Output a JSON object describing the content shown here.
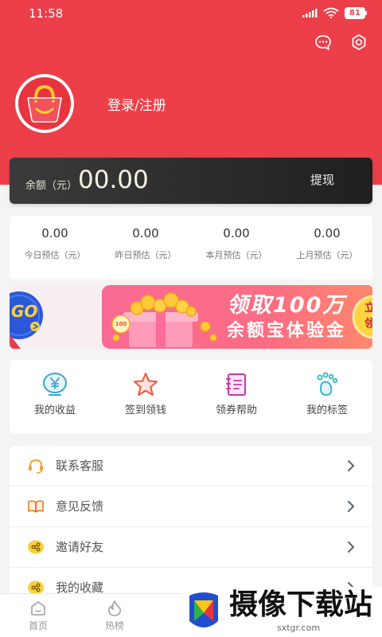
{
  "colors": {
    "brand_red": "#ec3f49",
    "page_bg": "#f4f4f4",
    "balance_card": "#2b2b2b",
    "chevron": "#5b6478"
  },
  "status_bar": {
    "time": "11:58",
    "battery_level": "81",
    "icons": [
      "signal-icon",
      "wifi-icon",
      "battery-icon"
    ]
  },
  "header": {
    "action_icons": [
      "message-icon",
      "settings-icon"
    ],
    "avatar_icon": "shopping-bag-avatar",
    "login_label": "登录/注册"
  },
  "balance": {
    "label": "余额（元）",
    "amount": "00.00",
    "withdraw_label": "提现"
  },
  "estimates": [
    {
      "value": "0.00",
      "label": "今日预估（元）"
    },
    {
      "value": "0.00",
      "label": "昨日预估（元）"
    },
    {
      "value": "0.00",
      "label": "本月预估（元）"
    },
    {
      "value": "0.00",
      "label": "上月预估（元）"
    }
  ],
  "banner": {
    "prev_slide_text": "GO",
    "headline": "领取100万",
    "subline": "余额宝体验金",
    "box_badge": "100",
    "badge_top": "立",
    "badge_bottom": "领"
  },
  "shortcuts": [
    {
      "label": "我的收益",
      "icon": "yuan-earnings-icon"
    },
    {
      "label": "签到领钱",
      "icon": "star-icon"
    },
    {
      "label": "领券帮助",
      "icon": "notebook-icon"
    },
    {
      "label": "我的标签",
      "icon": "footprint-icon"
    }
  ],
  "menu": [
    {
      "label": "联系客服",
      "icon": "headset-icon"
    },
    {
      "label": "意见反馈",
      "icon": "open-book-icon"
    },
    {
      "label": "邀请好友",
      "icon": "share-icon"
    },
    {
      "label": "我的收藏",
      "icon": "favorites-icon"
    }
  ],
  "tabbar": [
    {
      "label": "首页",
      "icon": "home-icon"
    },
    {
      "label": "热榜",
      "icon": "fire-icon"
    }
  ],
  "watermark": {
    "title": "摄像下载站",
    "domain": "sxtgr.com"
  }
}
